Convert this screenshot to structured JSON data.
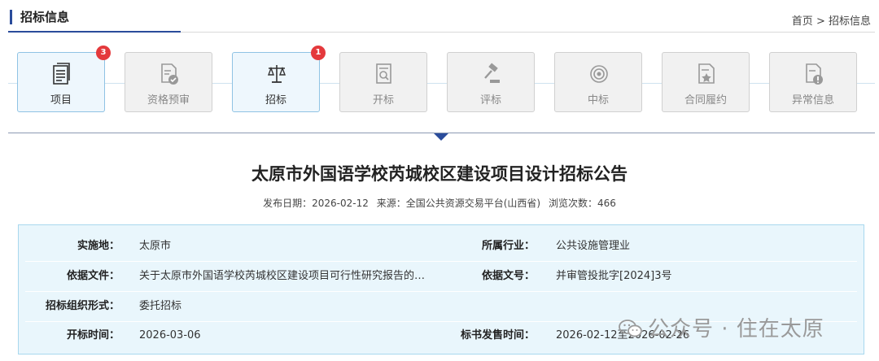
{
  "header": {
    "title": "招标信息",
    "breadcrumb": [
      "首页",
      ">",
      "招标信息"
    ]
  },
  "steps": [
    {
      "label": "项目",
      "active": true,
      "badge": "3",
      "icon": "document-icon"
    },
    {
      "label": "资格预审",
      "active": false,
      "badge": "",
      "icon": "checked-document-icon"
    },
    {
      "label": "招标",
      "active": true,
      "badge": "1",
      "icon": "scale-icon"
    },
    {
      "label": "开标",
      "active": false,
      "badge": "",
      "icon": "document-search-icon"
    },
    {
      "label": "评标",
      "active": false,
      "badge": "",
      "icon": "gavel-icon"
    },
    {
      "label": "中标",
      "active": false,
      "badge": "",
      "icon": "target-icon"
    },
    {
      "label": "合同履约",
      "active": false,
      "badge": "",
      "icon": "contract-star-icon"
    },
    {
      "label": "异常信息",
      "active": false,
      "badge": "",
      "icon": "warning-document-icon"
    }
  ],
  "announcement": {
    "title": "太原市外国语学校芮城校区建设项目设计招标公告",
    "publish_label": "发布日期：",
    "publish_date": "2026-02-12",
    "source_label": "来源：",
    "source": "全国公共资源交易平台(山西省)",
    "views_label": "浏览次数：",
    "views": "466"
  },
  "info": {
    "location_label": "实施地：",
    "location": "太原市",
    "industry_label": "所属行业：",
    "industry": "公共设施管理业",
    "basis_label": "依据文件：",
    "basis": "关于太原市外国语学校芮城校区建设项目可行性研究报告的…",
    "docno_label": "依据文号：",
    "docno": "并审管投批字[2024]3号",
    "org_label": "招标组织形式：",
    "org": "委托招标",
    "open_label": "开标时间：",
    "open_time": "2026-03-06",
    "sale_label": "标书发售时间：",
    "sale_time": "2026-02-12至2026-02-26"
  },
  "watermark": {
    "text": "公众号 · 住在太原"
  },
  "colors": {
    "accent": "#2a4c9b",
    "badge": "#e4393c",
    "info_bg": "#e9f6fc"
  }
}
